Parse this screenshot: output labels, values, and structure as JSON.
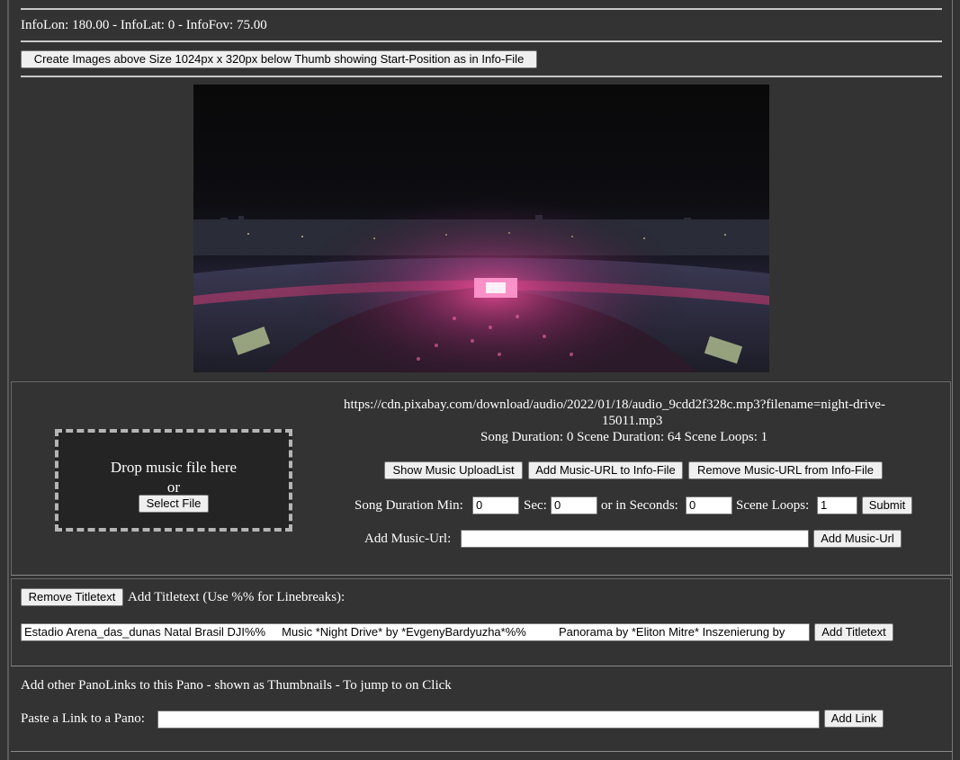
{
  "info": {
    "text": "InfoLon: 180.00 - InfoLat: 0 - InfoFov: 75.00"
  },
  "create_images_button": "Create Images above Size 1024px x 320px below Thumb showing Start-Position as in Info-File",
  "music": {
    "url_line1": "https://cdn.pixabay.com/download/audio/2022/01/18/audio_9cdd2f328c.mp3?filename=night-drive-",
    "url_line2": "15011.mp3",
    "durations": "Song Duration: 0 Scene Duration: 64 Scene Loops: 1",
    "drop_text": "Drop music file here",
    "or_text": "or",
    "select_file": "Select File",
    "show_upload_list": "Show Music UploadList",
    "add_url_to_info": "Add Music-URL to Info-File",
    "remove_url_from_info": "Remove Music-URL from Info-File",
    "song_duration_min_label": "Song Duration Min:",
    "song_duration_min_value": "0",
    "sec_label": "Sec:",
    "sec_value": "0",
    "or_seconds_label": "or in Seconds:",
    "seconds_value": "0",
    "scene_loops_label": "Scene Loops:",
    "scene_loops_value": "1",
    "submit": "Submit",
    "add_music_url_label": "Add Music-Url:",
    "add_music_url_value": "",
    "add_music_url_button": "Add Music-Url"
  },
  "titletext": {
    "remove_button": "Remove Titletext",
    "heading": "Add Titletext (Use %% for Linebreaks):",
    "value": "Estadio Arena_das_dunas Natal Brasil DJI%%     Music *Night Drive* by *EvgenyBardyuzha*%%          Panorama by *Eliton Mitre* Inszenierung by",
    "add_button": "Add Titletext"
  },
  "panolinks": {
    "heading": "Add other PanoLinks to this Pano - shown as Thumbnails - To jump to on Click",
    "paste_label": "Paste a Link to a Pano:",
    "paste_value": "",
    "add_button": "Add Link"
  },
  "image": {
    "description": "stadium-panorama-image"
  }
}
